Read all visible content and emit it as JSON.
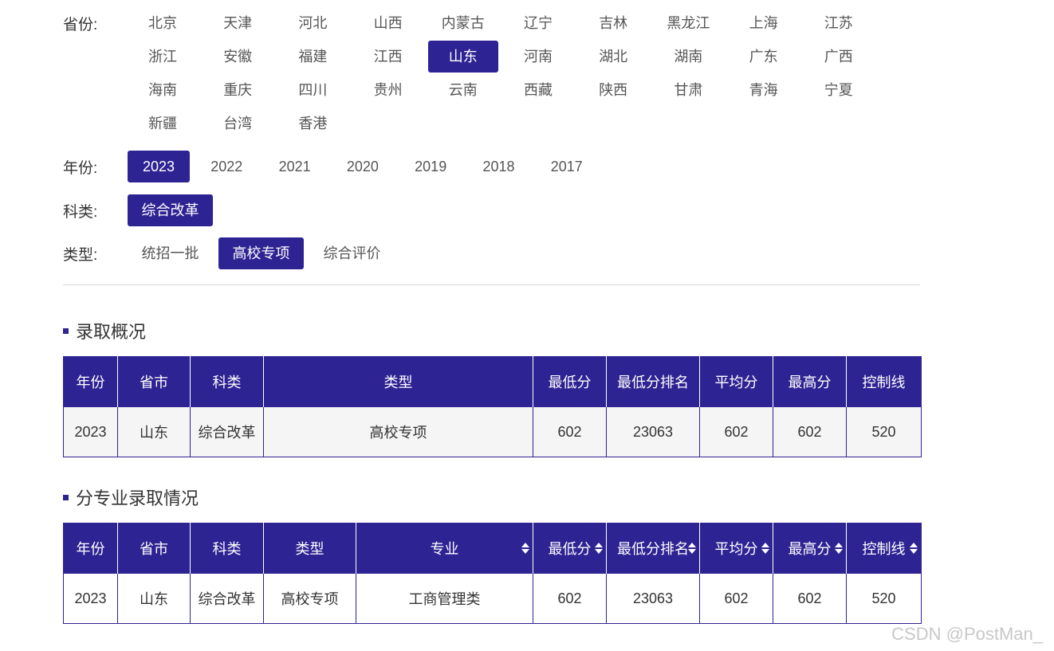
{
  "filters": {
    "province_label": "省份:",
    "provinces": [
      "北京",
      "天津",
      "河北",
      "山西",
      "内蒙古",
      "辽宁",
      "吉林",
      "黑龙江",
      "上海",
      "江苏",
      "浙江",
      "安徽",
      "福建",
      "江西",
      "山东",
      "河南",
      "湖北",
      "湖南",
      "广东",
      "广西",
      "海南",
      "重庆",
      "四川",
      "贵州",
      "云南",
      "西藏",
      "陕西",
      "甘肃",
      "青海",
      "宁夏",
      "新疆",
      "台湾",
      "香港"
    ],
    "selected_province": "山东",
    "year_label": "年份:",
    "years": [
      "2023",
      "2022",
      "2021",
      "2020",
      "2019",
      "2018",
      "2017"
    ],
    "selected_year": "2023",
    "subject_label": "科类:",
    "subjects": [
      "综合改革"
    ],
    "selected_subject": "综合改革",
    "type_label": "类型:",
    "types": [
      "统招一批",
      "高校专项",
      "综合评价"
    ],
    "selected_type": "高校专项"
  },
  "summary": {
    "title": "录取概况",
    "headers": [
      "年份",
      "省市",
      "科类",
      "类型",
      "最低分",
      "最低分排名",
      "平均分",
      "最高分",
      "控制线"
    ],
    "rows": [
      [
        "2023",
        "山东",
        "综合改革",
        "高校专项",
        "602",
        "23063",
        "602",
        "602",
        "520"
      ]
    ]
  },
  "major": {
    "title": "分专业录取情况",
    "headers": [
      "年份",
      "省市",
      "科类",
      "类型",
      "专业",
      "最低分",
      "最低分排名",
      "平均分",
      "最高分",
      "控制线"
    ],
    "sortable": [
      false,
      false,
      false,
      false,
      true,
      true,
      true,
      true,
      true,
      true
    ],
    "rows": [
      [
        "2023",
        "山东",
        "综合改革",
        "高校专项",
        "工商管理类",
        "602",
        "23063",
        "602",
        "602",
        "520"
      ]
    ]
  },
  "watermark": "CSDN @PostMan_",
  "colors": {
    "accent": "#2e2393",
    "divider": "#d9d9d9",
    "row_alt": "#f5f5f5"
  }
}
